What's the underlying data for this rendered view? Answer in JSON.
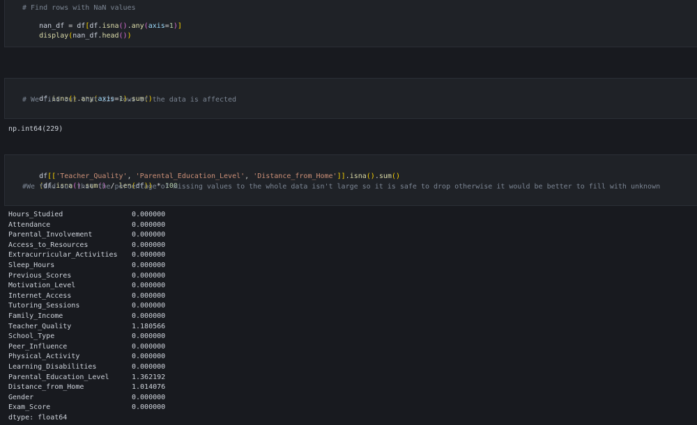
{
  "cell1": {
    "line1": "# Find rows with NaN values",
    "line2_parts": [
      "nan_df",
      " = ",
      "df",
      "[",
      "df",
      ".",
      "isna",
      "()",
      ".",
      "any",
      "(",
      "axis",
      "=",
      "1",
      ")",
      "]"
    ],
    "line3_parts": [
      "display",
      "(",
      "nan_df",
      ".",
      "head",
      "()",
      ")"
    ]
  },
  "cell2": {
    "line1_parts": [
      "df",
      ".",
      "isna",
      "()",
      ".",
      "any",
      "(",
      "axis",
      "=",
      "1",
      ")",
      ".",
      "sum",
      "()"
    ],
    "line2": "# We find out that 229 rows of the data is affected"
  },
  "output2": "np.int64(229)",
  "cell3": {
    "line1_parts": [
      "df",
      "[[",
      "'Teacher_Quality'",
      ", ",
      "'Parental_Education_Level'",
      ", ",
      "'Distance_from_Home'",
      "]]",
      ".",
      "isna",
      "()",
      ".",
      "sum",
      "()"
    ],
    "line2_parts": [
      "(",
      "df",
      ".",
      "isna",
      "()",
      ".",
      "sum",
      "()",
      " / ",
      "len",
      "(",
      "df",
      "))",
      " * ",
      "100"
    ],
    "line3": "#We find out that the percentage of missing values to the whole data isn't large so it is safe to drop otherwise it would be better to fill with unknown"
  },
  "output3": {
    "rows": [
      {
        "name": "Hours_Studied",
        "value": "0.000000"
      },
      {
        "name": "Attendance",
        "value": "0.000000"
      },
      {
        "name": "Parental_Involvement",
        "value": "0.000000"
      },
      {
        "name": "Access_to_Resources",
        "value": "0.000000"
      },
      {
        "name": "Extracurricular_Activities",
        "value": "0.000000"
      },
      {
        "name": "Sleep_Hours",
        "value": "0.000000"
      },
      {
        "name": "Previous_Scores",
        "value": "0.000000"
      },
      {
        "name": "Motivation_Level",
        "value": "0.000000"
      },
      {
        "name": "Internet_Access",
        "value": "0.000000"
      },
      {
        "name": "Tutoring_Sessions",
        "value": "0.000000"
      },
      {
        "name": "Family_Income",
        "value": "0.000000"
      },
      {
        "name": "Teacher_Quality",
        "value": "1.180566"
      },
      {
        "name": "School_Type",
        "value": "0.000000"
      },
      {
        "name": "Peer_Influence",
        "value": "0.000000"
      },
      {
        "name": "Physical_Activity",
        "value": "0.000000"
      },
      {
        "name": "Learning_Disabilities",
        "value": "0.000000"
      },
      {
        "name": "Parental_Education_Level",
        "value": "1.362192"
      },
      {
        "name": "Distance_from_Home",
        "value": "1.014076"
      },
      {
        "name": "Gender",
        "value": "0.000000"
      },
      {
        "name": "Exam_Score",
        "value": "0.000000"
      }
    ],
    "dtype": "dtype: float64"
  }
}
